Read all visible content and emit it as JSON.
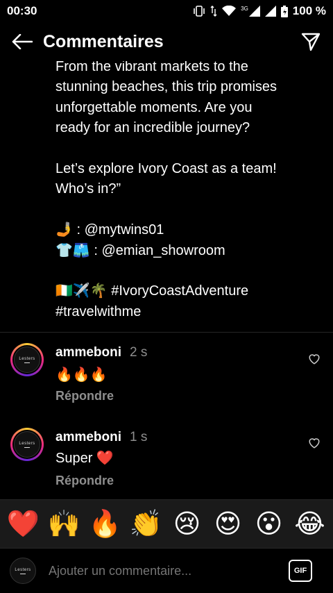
{
  "status_bar": {
    "time": "00:30",
    "network": "3G",
    "battery": "100 %"
  },
  "header": {
    "title": "Commentaires",
    "back_icon": "arrow-left-icon",
    "send_icon": "send-icon"
  },
  "post": {
    "caption": "From the vibrant markets to the\nstunning beaches, this trip promises\nunforgettable moments. Are you\nready for an incredible journey?\n\nLet’s explore Ivory Coast as a team!\nWho’s in?”\n\n🤳 : @mytwins01\n👕🩳 : @emian_showroom\n\n🇨🇮✈️🌴 #IvoryCoastAdventure\n#travelwithme"
  },
  "comments": [
    {
      "user": "ammeboni",
      "time": "2 s",
      "text": "🔥🔥🔥",
      "reply_label": "Répondre",
      "avatar_text": "Lesters"
    },
    {
      "user": "ammeboni",
      "time": "1 s",
      "text": "Super ❤️",
      "reply_label": "Répondre",
      "avatar_text": "Lesters"
    }
  ],
  "reactions": [
    "❤️",
    "🙌",
    "🔥",
    "👏",
    "😢",
    "😍",
    "😮",
    "😂"
  ],
  "composer": {
    "placeholder": "Ajouter un commentaire...",
    "gif_label": "GIF",
    "avatar_text": "Lesters"
  }
}
